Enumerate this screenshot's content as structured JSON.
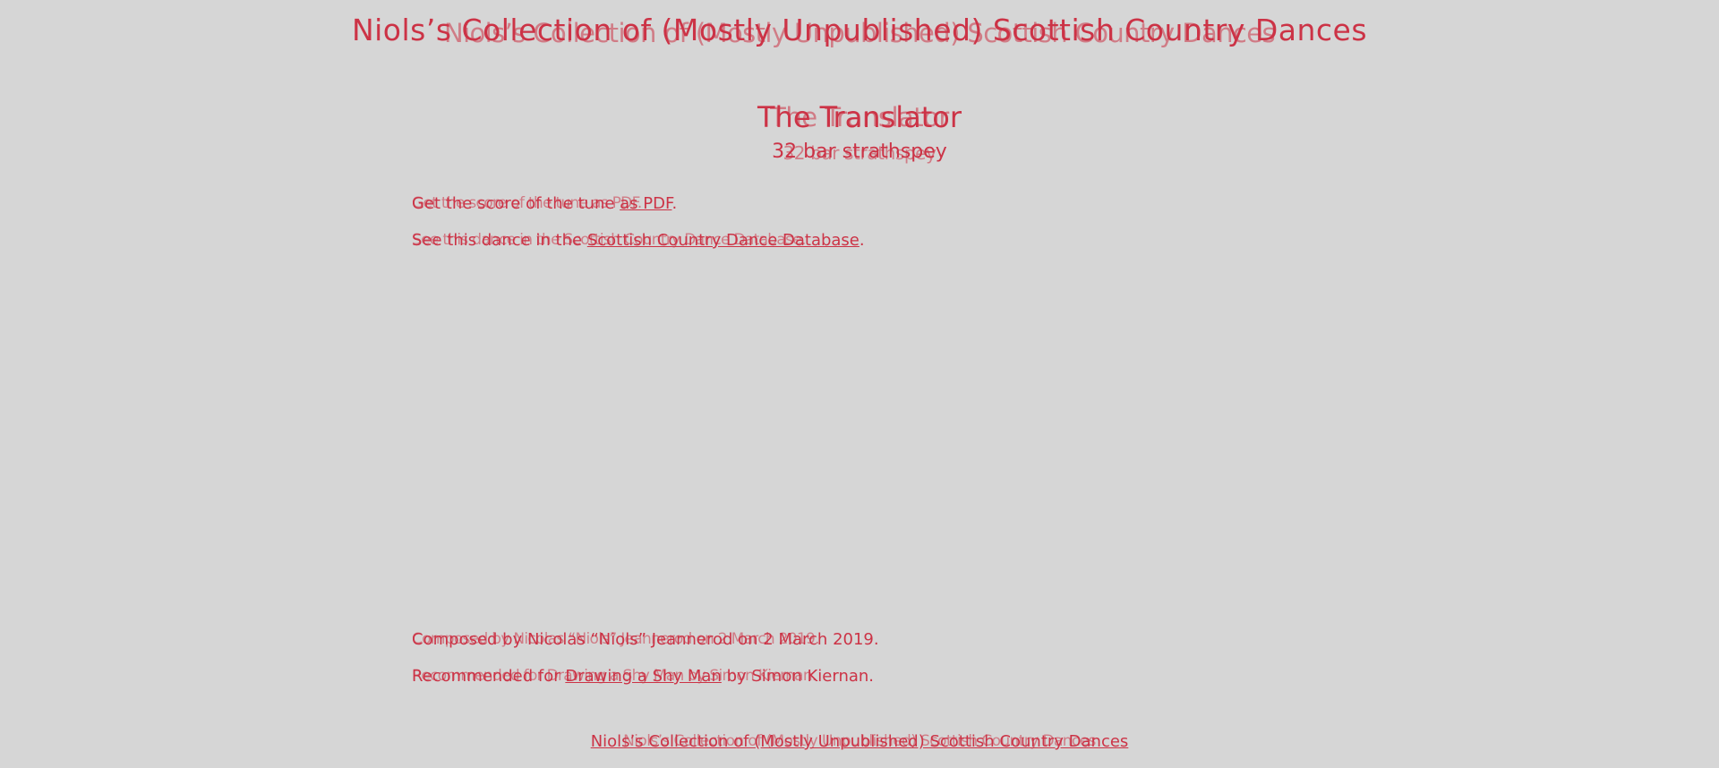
{
  "header": {
    "site_title": "Niols’s Collection of (Mostly Unpublished) Scottish Country Dances"
  },
  "dance": {
    "title": "The Translator",
    "type": "32 bar strathspey"
  },
  "links": {
    "score_prefix": "Get the score of the tune ",
    "score_link": "as PDF",
    "score_suffix": ".",
    "database_prefix": "See this dance in the ",
    "database_link": "Scottish Country Dance Database",
    "database_suffix": "."
  },
  "credits": {
    "composed": "Composed by Nicolas “Niols” Jeannerod on 2 March 2019.",
    "recommended_prefix": "Recommended for ",
    "recommended_link": "Drawing a Shy Man",
    "recommended_suffix": " by Simon Kiernan."
  },
  "ghost": {
    "site_title": "Niols’s Collection of (Mostly Unpublished) Scottish Country Dances",
    "dance_title": "The Translator",
    "dance_type": "32 bar strathspey",
    "score_line": "Get the score of the tune as PDF.",
    "database_line": "See this dance in the Scottish Country Dance Database.",
    "composed": "Composed by Nicolas “Niols” Jeannerod on 2 March 2019.",
    "recommended": "Recommended for Drawing a Shy Man by Simon Kiernan.",
    "footer": "Niols’s Collection of (Mostly Unpublished) Scottish Country Dances"
  },
  "footer": {
    "link": "Niols’s Collection of (Mostly Unpublished) Scottish Country Dances"
  },
  "colors": {
    "background": "#d6d6d6",
    "text": "#cc3346"
  }
}
